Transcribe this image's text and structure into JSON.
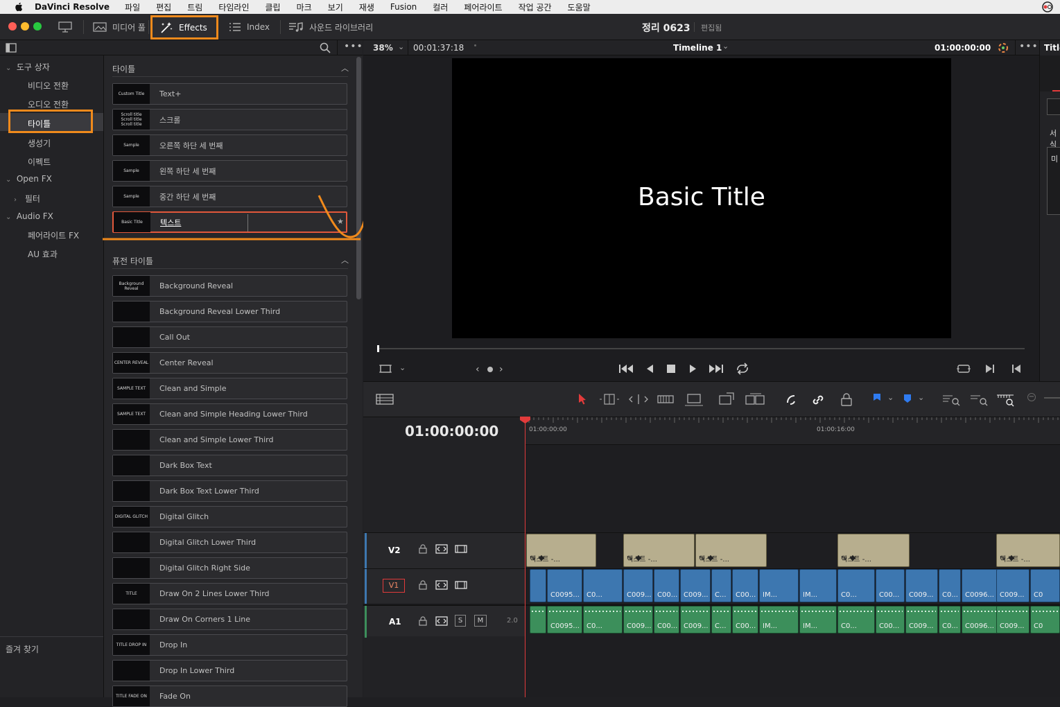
{
  "menubar": {
    "app_name": "DaVinci Resolve",
    "items": [
      "파일",
      "편집",
      "트림",
      "타임라인",
      "클립",
      "마크",
      "보기",
      "재생",
      "Fusion",
      "컬러",
      "페어라이트",
      "작업 공간",
      "도움말"
    ]
  },
  "toolbar": {
    "media_pool": "미디어 풀",
    "effects": "Effects",
    "index": "Index",
    "sound_library": "사운드 라이브러리",
    "project_name": "정리 0623",
    "project_state": "편집됨"
  },
  "sidebar": {
    "toolbox": "도구 상자",
    "video_transitions": "비디오 전환",
    "audio_transitions": "오디오 전환",
    "titles": "타이틀",
    "generators": "생성기",
    "effects": "이펙트",
    "open_fx": "Open FX",
    "filters": "필터",
    "audio_fx": "Audio FX",
    "fairlight_fx": "페어라이트 FX",
    "au_effects": "AU 효과",
    "favorites": "즐겨 찾기"
  },
  "titles_section": {
    "header": "타이틀",
    "items": [
      {
        "thumb": "Custom Title",
        "label": "Text+"
      },
      {
        "thumb": "Scroll title\nScroll title\nScroll title",
        "label": "스크롤"
      },
      {
        "thumb": "Sample",
        "label": "오른쪽 하단 세 번째"
      },
      {
        "thumb": "Sample",
        "label": "왼쪽 하단 세 번째"
      },
      {
        "thumb": "Sample",
        "label": "중간 하단 세 번째"
      },
      {
        "thumb": "Basic Title",
        "label": "텍스트"
      }
    ]
  },
  "fusion_section": {
    "header": "퓨전 타이틀",
    "items": [
      {
        "thumb": "Background Reveal",
        "label": "Background Reveal"
      },
      {
        "thumb": "",
        "label": "Background Reveal Lower Third"
      },
      {
        "thumb": "",
        "label": "Call Out"
      },
      {
        "thumb": "CENTER REVEAL",
        "label": "Center Reveal"
      },
      {
        "thumb": "SAMPLE TEXT",
        "label": "Clean and Simple"
      },
      {
        "thumb": "SAMPLE TEXT",
        "label": "Clean and Simple Heading Lower Third"
      },
      {
        "thumb": "",
        "label": "Clean and Simple Lower Third"
      },
      {
        "thumb": "",
        "label": "Dark Box Text"
      },
      {
        "thumb": "",
        "label": "Dark Box Text Lower Third"
      },
      {
        "thumb": "DIGITAL GLITCH",
        "label": "Digital Glitch"
      },
      {
        "thumb": "",
        "label": "Digital Glitch Lower Third"
      },
      {
        "thumb": "",
        "label": "Digital Glitch Right Side"
      },
      {
        "thumb": "TITLE",
        "label": "Draw On 2 Lines Lower Third"
      },
      {
        "thumb": "",
        "label": "Draw On Corners 1 Line"
      },
      {
        "thumb": "TITLE DROP IN",
        "label": "Drop In"
      },
      {
        "thumb": "",
        "label": "Drop In Lower Third"
      },
      {
        "thumb": "TITLE FADE ON",
        "label": "Fade On"
      }
    ]
  },
  "viewer": {
    "zoom": "38%",
    "timecode_source": "00:01:37:18",
    "timeline_name": "Timeline 1",
    "timecode": "01:00:00:00",
    "screen_text": "Basic Title",
    "inspector_tab": "Title",
    "inspector_label_1": "서식",
    "inspector_label_2": "미"
  },
  "timeline": {
    "current_timecode": "01:00:00:00",
    "ruler_1": "01:00:00:00",
    "ruler_2": "01:00:16:00",
    "tracks": {
      "v2": "V2",
      "v1": "V1",
      "a1": "A1",
      "a1_level": "2.0",
      "solo": "S",
      "mute": "M"
    },
    "v2_clips": [
      "텍스트 -...",
      "텍스트 -...",
      "텍스트 -...",
      "텍스트 -...",
      "텍스트 -..."
    ],
    "v1_clips": [
      "C0095...",
      "C0...",
      "C009...",
      "C00...",
      "C009...",
      "C...",
      "C00...",
      "IM...",
      "IM...",
      "C0...",
      "C00...",
      "C009...",
      "C0...",
      "C0096...",
      "C009...",
      "C0"
    ],
    "a1_clips": [
      "C0095...",
      "C0...",
      "C009...",
      "C00...",
      "C009...",
      "C...",
      "C00...",
      "IM...",
      "IM...",
      "C0...",
      "C00...",
      "C009...",
      "C0...",
      "C0096...",
      "C009...",
      "C0"
    ]
  },
  "colors": {
    "highlight": "#f08a1c",
    "video_clip": "#3d77b0",
    "audio_clip": "#3c8f5b",
    "title_clip": "#b7ae8e",
    "playhead": "#e23b3b"
  }
}
